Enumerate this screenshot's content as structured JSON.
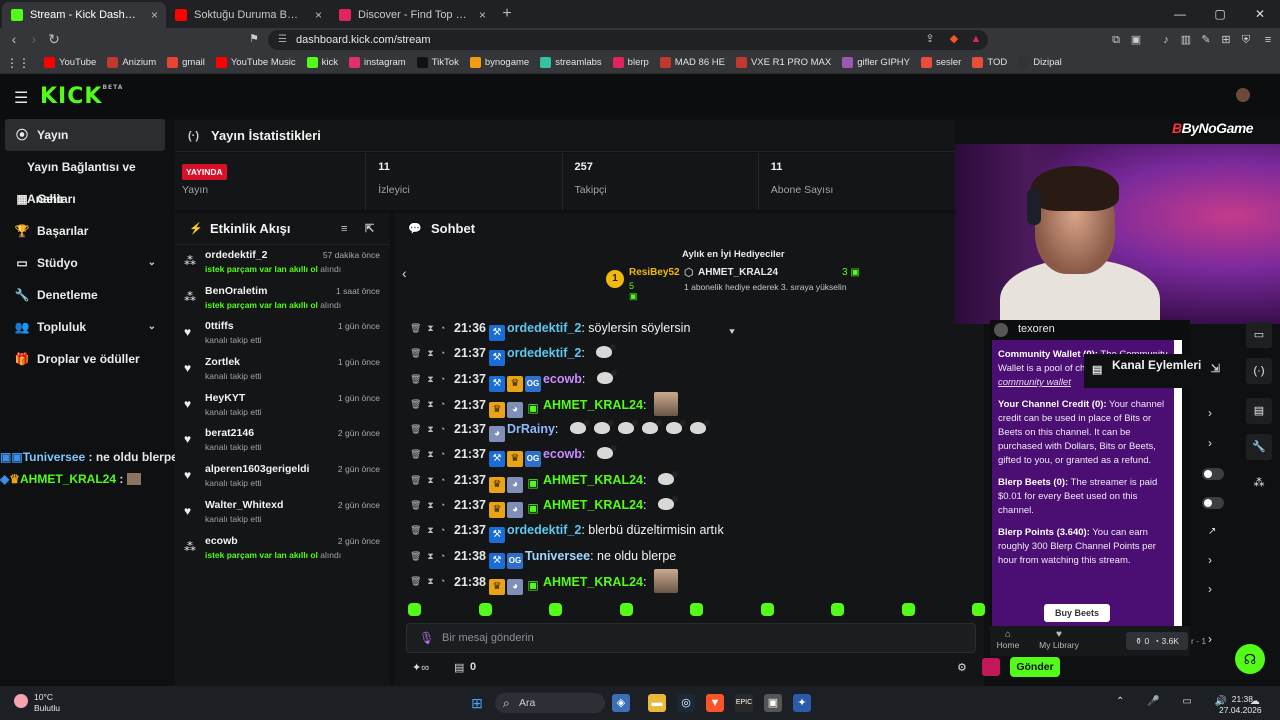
{
  "browser": {
    "tabs": [
      {
        "title": "Stream - Kick Dashboard",
        "fav_color": "#53fc18",
        "active": true
      },
      {
        "title": "Soktuğu Duruma Bak | YouTube Music",
        "fav_color": "#ff0000",
        "active": false
      },
      {
        "title": "Discover - Find Top Blerps, Streamers",
        "fav_color": "#e0245e",
        "active": false
      }
    ],
    "url": "dashboard.kick.com/stream",
    "bookmarks": [
      {
        "label": "YouTube",
        "color": "#ff0000"
      },
      {
        "label": "Anizium",
        "color": "#c0392b"
      },
      {
        "label": "gmail",
        "color": "#ea4335"
      },
      {
        "label": "YouTube Music",
        "color": "#ff0000"
      },
      {
        "label": "kick",
        "color": "#53fc18"
      },
      {
        "label": "instagram",
        "color": "#e1306c"
      },
      {
        "label": "TikTok",
        "color": "#111111"
      },
      {
        "label": "bynogame",
        "color": "#f39c12"
      },
      {
        "label": "streamlabs",
        "color": "#31c3a2"
      },
      {
        "label": "blerp",
        "color": "#e0245e"
      },
      {
        "label": "MAD 86 HE",
        "color": "#c0392b"
      },
      {
        "label": "VXE R1 PRO MAX",
        "color": "#c0392b"
      },
      {
        "label": "gifler GIPHY",
        "color": "#9b59b6"
      },
      {
        "label": "sesler",
        "color": "#e74c3c"
      },
      {
        "label": "TOD",
        "color": "#e74c3c"
      },
      {
        "label": "Dizipal",
        "color": "#333333"
      }
    ]
  },
  "kick": {
    "logo": "KICK",
    "logo_sup": "BETA",
    "sidebar": [
      {
        "label": "Yayın",
        "icon": "broadcast-icon",
        "glyph": "⦿",
        "active": true
      },
      {
        "label": "Yayın Bağlantısı ve Anahtarı",
        "sub": true
      },
      {
        "label": "Gelir",
        "icon": "chart-icon",
        "glyph": "▦"
      },
      {
        "label": "Başarılar",
        "icon": "trophy-icon",
        "glyph": "🏆"
      },
      {
        "label": "Stüdyo",
        "icon": "tv-icon",
        "glyph": "▭",
        "chevron": true
      },
      {
        "label": "Denetleme",
        "icon": "wrench-icon",
        "glyph": "🔧"
      },
      {
        "label": "Topluluk",
        "icon": "users-icon",
        "glyph": "👥",
        "chevron": true
      },
      {
        "label": "Droplar ve ödüller",
        "icon": "gift-icon",
        "glyph": "🎁"
      }
    ],
    "side_chat": [
      {
        "user": "Tuniversee",
        "text": " : ne oldu blerpe"
      },
      {
        "user": "AHMET_KRAL24",
        "text": " : "
      }
    ],
    "stats": {
      "title": "Yayın İstatistikleri",
      "live": "YAYINDA",
      "items": [
        {
          "value": "",
          "label": "Yayın"
        },
        {
          "value": "11",
          "label": "İzleyici"
        },
        {
          "value": "257",
          "label": "Takipçi"
        },
        {
          "value": "11",
          "label": "Abone Sayısı"
        }
      ]
    },
    "feed": {
      "title": "Etkinlik Akışı",
      "items": [
        {
          "name": "ordedektif_2",
          "time": "57 dakika önce",
          "desc_hl": "istek parçam var lan akıllı ol",
          "desc": " alındı",
          "icon": "blerp-icon",
          "glyph": "⁂"
        },
        {
          "name": "BenOraletim",
          "time": "1 saat önce",
          "desc_hl": "istek parçam var lan akıllı ol",
          "desc": " alındı",
          "icon": "blerp-icon",
          "glyph": "⁂"
        },
        {
          "name": "0ttiffs",
          "time": "1 gün önce",
          "desc_hl": "",
          "desc": "kanalı takip etti",
          "icon": "heart-icon",
          "glyph": "♥"
        },
        {
          "name": "Zortlek",
          "time": "1 gün önce",
          "desc_hl": "",
          "desc": "kanalı takip etti",
          "icon": "heart-icon",
          "glyph": "♥"
        },
        {
          "name": "HeyKYT",
          "time": "1 gün önce",
          "desc_hl": "",
          "desc": "kanalı takip etti",
          "icon": "heart-icon",
          "glyph": "♥"
        },
        {
          "name": "berat2146",
          "time": "2 gün önce",
          "desc_hl": "",
          "desc": "kanalı takip etti",
          "icon": "heart-icon",
          "glyph": "♥"
        },
        {
          "name": "alperen1603gerigeldi",
          "time": "2 gün önce",
          "desc_hl": "",
          "desc": "kanalı takip etti",
          "icon": "heart-icon",
          "glyph": "♥"
        },
        {
          "name": "Walter_Whitexd",
          "time": "2 gün önce",
          "desc_hl": "",
          "desc": "kanalı takip etti",
          "icon": "heart-icon",
          "glyph": "♥"
        },
        {
          "name": "ecowb",
          "time": "2 gün önce",
          "desc_hl": "istek parçam var lan akıllı ol",
          "desc": " alındı",
          "icon": "blerp-icon",
          "glyph": "⁂"
        }
      ]
    },
    "chat": {
      "title": "Sohbet",
      "gifters_title": "Aylık en İyi Hediyeciler",
      "top1": {
        "rank": "1",
        "name": "ResiBey52",
        "count": "5"
      },
      "top2": {
        "name": "AHMET_KRAL24",
        "count": "3",
        "sub": "1 abonelik hediye ederek 3. sıraya yükselin"
      },
      "messages": [
        {
          "time": "21:36",
          "badges": [
            "blue"
          ],
          "user": "ordedektif_2",
          "color": "c-teal",
          "text": "söylersin söylersin",
          "emotes": 0,
          "photo": false
        },
        {
          "time": "21:37",
          "badges": [
            "blue"
          ],
          "user": "ordedektif_2",
          "color": "c-teal",
          "text": "",
          "emotes": 1,
          "photo": false
        },
        {
          "time": "21:37",
          "badges": [
            "blue",
            "gold",
            "og"
          ],
          "user": "ecowb",
          "color": "c-purple",
          "text": "",
          "emotes": 1,
          "photo": false
        },
        {
          "time": "21:37",
          "badges": [
            "gold",
            "anime",
            "gift"
          ],
          "user": "AHMET_KRAL24",
          "color": "c-green",
          "text": "",
          "emotes": 0,
          "photo": true
        },
        {
          "time": "21:37",
          "badges": [
            "anime"
          ],
          "user": "DrRainy",
          "color": "c-blue",
          "text": "",
          "emotes": 6,
          "photo": false
        },
        {
          "time": "21:37",
          "badges": [
            "blue",
            "gold",
            "og"
          ],
          "user": "ecowb",
          "color": "c-purple",
          "text": "",
          "emotes": 1,
          "photo": false
        },
        {
          "time": "21:37",
          "badges": [
            "gold",
            "anime",
            "gift"
          ],
          "user": "AHMET_KRAL24",
          "color": "c-green",
          "text": "",
          "emotes": 1,
          "photo": false
        },
        {
          "time": "21:37",
          "badges": [
            "gold",
            "anime",
            "gift"
          ],
          "user": "AHMET_KRAL24",
          "color": "c-green",
          "text": "",
          "emotes": 1,
          "photo": false
        },
        {
          "time": "21:37",
          "badges": [
            "blue"
          ],
          "user": "ordedektif_2",
          "color": "c-teal",
          "text": "blerbü düzeltirmisin artık",
          "emotes": 0,
          "photo": false
        },
        {
          "time": "21:38",
          "badges": [
            "blue",
            "og"
          ],
          "user": "Tuniversee",
          "color": "c-lblue",
          "text": "ne oldu blerpe",
          "emotes": 0,
          "photo": false
        },
        {
          "time": "21:38",
          "badges": [
            "gold",
            "anime",
            "gift"
          ],
          "user": "AHMET_KRAL24",
          "color": "c-green",
          "text": "",
          "emotes": 0,
          "photo": true
        }
      ],
      "input_placeholder": "Bir mesaj gönderin",
      "points": "0",
      "send_label": "Gönder"
    }
  },
  "overlay": {
    "username": "texoren",
    "wallet_title": "Community Wallet (0):",
    "wallet_text": " The Community Wallet is a pool of channel credit.",
    "wallet_link": "community wallet",
    "credit_title": "Your Channel Credit (0):",
    "credit_text": " Your channel credit can be used in place of Bits or Beets on this channel. It can be purchased with Dollars, Bits or Beets, gifted to you, or granted as a refund.",
    "beets_title": "Blerp Beets (0):",
    "beets_text": " The streamer is paid $0.01 for every Beet used on this channel.",
    "points_title": "Blerp Points (3.640):",
    "points_text": " You can earn roughly 300 Blerp Channel Points per hour from watching this stream.",
    "buy_label": "Buy Beets",
    "nav_home": "Home",
    "nav_library": "My Library",
    "credits": "0",
    "points_short": "3.6K",
    "pager": "r - 1"
  },
  "kanal": {
    "title": "Kanal Eylemleri"
  },
  "webcam": {
    "brand": "ByNoGame"
  },
  "taskbar": {
    "temp": "10°C",
    "weather": "Bulutlu",
    "search": "Ara",
    "time": "21:38",
    "date": "27.04.2026"
  }
}
